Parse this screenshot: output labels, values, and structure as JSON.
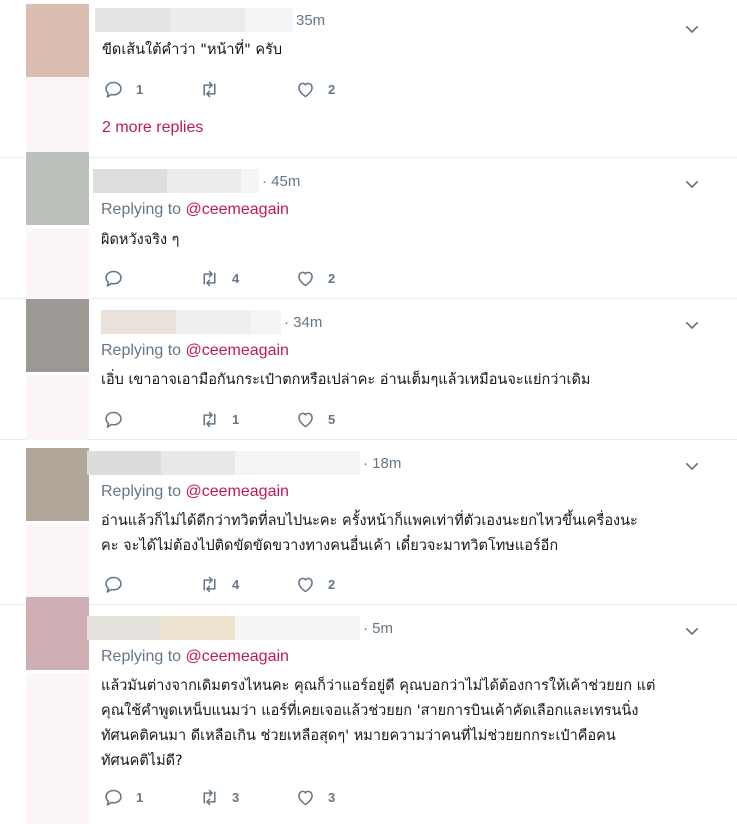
{
  "colors": {
    "accent": "#c2185b",
    "muted": "#657786",
    "text": "#14171a",
    "divider": "#e6ecf0"
  },
  "icons": {
    "reply": "reply-icon",
    "retweet": "retweet-icon",
    "like": "heart-icon",
    "menu": "chevron-down-icon"
  },
  "tweets": [
    {
      "time": "35m",
      "replying_label": "",
      "replying_handle": "",
      "text": "ขีดเส้นใต้คำว่า \"หน้าที่\" ครับ",
      "replies": "1",
      "retweets": "",
      "likes": "2",
      "more_replies": "2 more replies"
    },
    {
      "time": "· 45m",
      "replying_label": "Replying to ",
      "replying_handle": "@ceemeagain",
      "text": "ผิดหวังจริง ๆ",
      "replies": "",
      "retweets": "4",
      "likes": "2"
    },
    {
      "time": "· 34m",
      "replying_label": "Replying to ",
      "replying_handle": "@ceemeagain",
      "text": "เอิ่บ เขาอาจเอามือกันกระเป๋าตกหรือเปล่าคะ อ่านเต็มๆแล้วเหมือนจะแย่กว่าเดิม",
      "replies": "",
      "retweets": "1",
      "likes": "5"
    },
    {
      "time": "· 18m",
      "replying_label": "Replying to ",
      "replying_handle": "@ceemeagain",
      "text": "อ่านแล้วก็ไม่ได้ดีกว่าทวิตที่ลบไปนะคะ ครั้งหน้าก็แพคเท่าที่ตัวเองนะยกไหวขึ้นเครื่องนะ\nคะ จะได้ไม่ต้องไปติดขัดขัดขวางทางคนอื่นเค้า เดี๋ยวจะมาทวิตโทษแอร์อีก",
      "replies": "",
      "retweets": "4",
      "likes": "2"
    },
    {
      "time": "· 5m",
      "replying_label": "Replying to ",
      "replying_handle": "@ceemeagain",
      "text": "แล้วมันต่างจากเดิมตรงไหนคะ คุณก็ว่าแอร์อยู่ดี คุณบอกว่าไม่ได้ต้องการให้เค้าช่วยยก แต่\nคุณใช้คำพูดเหน็บแนมว่า แอร์ที่เคยเจอแล้วช่วยยก 'สายการบินเค้าคัดเลือกและเทรนนิ่ง\nทัศนคติคนมา ดีเหลือเกิน ช่วยเหลือสุดๆ' หมายความว่าคนที่ไม่ช่วยยกกระเป๋าคือคน\nทัศนคติไม่ดี?",
      "replies": "1",
      "retweets": "3",
      "likes": "3"
    }
  ]
}
